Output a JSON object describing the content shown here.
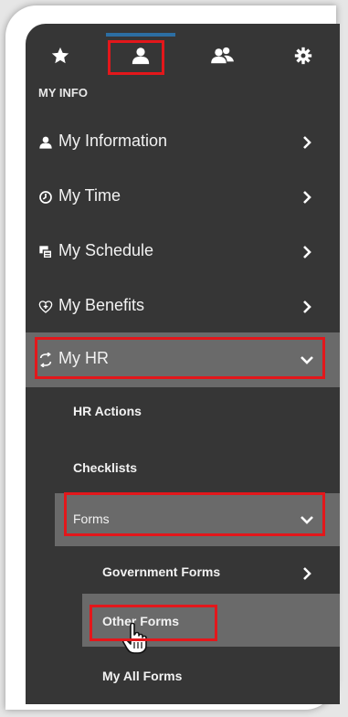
{
  "tabs": [
    {
      "name": "favorites",
      "icon": "star-icon"
    },
    {
      "name": "my-info",
      "icon": "person-icon",
      "active": true
    },
    {
      "name": "team",
      "icon": "people-icon"
    },
    {
      "name": "settings",
      "icon": "gear-icon"
    }
  ],
  "section": {
    "title": "MY INFO"
  },
  "menu": {
    "my_information": "My Information",
    "my_time": "My Time",
    "my_schedule": "My Schedule",
    "my_benefits": "My Benefits",
    "my_hr": "My HR",
    "hr_actions": "HR Actions",
    "checklists": "Checklists",
    "forms": "Forms",
    "government_forms": "Government Forms",
    "other_forms": "Other Forms",
    "my_all_forms": "My All Forms"
  },
  "colors": {
    "panel": "#363636",
    "selected_band": "#6a6a6a",
    "active_tab_bar": "#2c6ea3",
    "highlight": "#e3171b"
  }
}
